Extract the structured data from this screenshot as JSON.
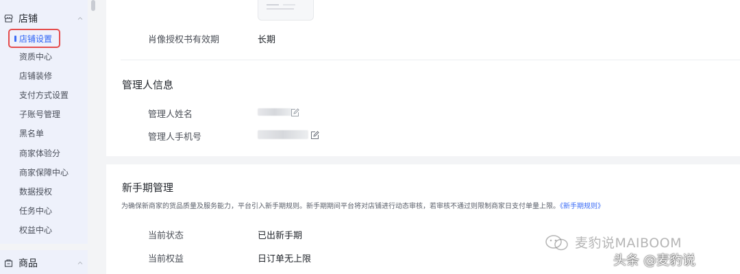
{
  "sidebar": {
    "store_group": {
      "label": "店铺",
      "icon": "store-icon"
    },
    "items": [
      {
        "label": "店铺设置",
        "active": true
      },
      {
        "label": "资质中心"
      },
      {
        "label": "店铺装修"
      },
      {
        "label": "支付方式设置"
      },
      {
        "label": "子账号管理"
      },
      {
        "label": "黑名单"
      },
      {
        "label": "商家体验分"
      },
      {
        "label": "商家保障中心"
      },
      {
        "label": "数据授权"
      },
      {
        "label": "任务中心"
      },
      {
        "label": "权益中心"
      }
    ],
    "goods_group": {
      "label": "商品",
      "icon": "goods-icon"
    },
    "colors": {
      "active": "#2f63f5",
      "highlight_box": "#e54b4b",
      "bg": "#eef1fb"
    }
  },
  "portrait_section": {
    "validity_label": "肖像授权书有效期",
    "validity_value": "长期"
  },
  "manager_section": {
    "title": "管理人信息",
    "name_label": "管理人姓名",
    "phone_label": "管理人手机号"
  },
  "newbie_section": {
    "title": "新手期管理",
    "description": "为确保新商家的货品质量及服务能力，平台引入新手期规则。新手期期间平台将对店铺进行动态审核，若审核不通过则限制商家日支付单量上限。",
    "rule_link": "《新手期规则》",
    "status_label": "当前状态",
    "status_value": "已出新手期",
    "rights_label": "当前权益",
    "rights_value": "日订单无上限"
  },
  "watermark": {
    "line1": "麦豹说MAIBOOM",
    "line2": "头条 @麦豹说"
  }
}
